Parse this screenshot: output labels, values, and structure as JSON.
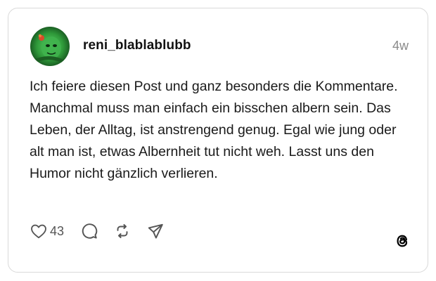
{
  "post": {
    "username": "reni_blablablubb",
    "timestamp": "4w",
    "text": "Ich feiere diesen Post und ganz besonders die Kommentare. Manchmal muss man einfach ein bisschen albern sein. Das Leben, der Alltag, ist anstrengend genug. Egal wie jung oder alt man ist, etwas Albernheit tut nicht weh. Lasst uns den Humor nicht gänzlich verlieren.",
    "like_count": "43"
  },
  "icons": {
    "like": "heart-icon",
    "comment": "comment-bubble-icon",
    "repost": "repost-icon",
    "share": "send-icon",
    "brand": "threads-logo-icon"
  },
  "colors": {
    "text": "#1a1a1a",
    "muted": "#8a8a8a",
    "icon": "#555555",
    "border": "#d9d9d9",
    "avatar_green": "#2f9a3a"
  }
}
